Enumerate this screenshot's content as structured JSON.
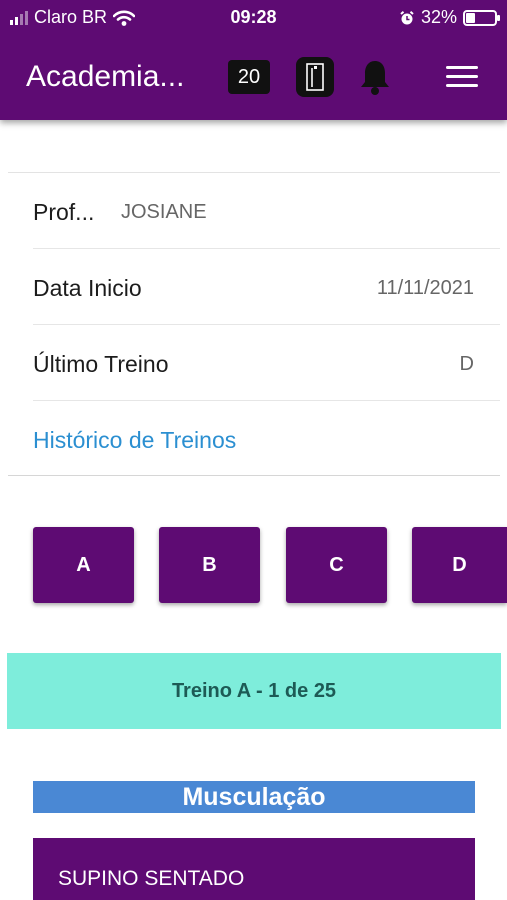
{
  "status_bar": {
    "carrier": "Claro BR",
    "time": "09:28",
    "battery_percent": "32%",
    "battery_level": 0.32
  },
  "header": {
    "title": "Academia...",
    "badge_count": "20",
    "door_icon": "door-icon",
    "bell_icon": "bell-icon",
    "menu_icon": "hamburger-menu-icon",
    "bg_color": "#5e0b73"
  },
  "info": {
    "professor_label": "Prof...",
    "professor_value": "JOSIANE",
    "start_label": "Data Inicio",
    "start_value": "11/11/2021",
    "last_label": "Último Treino",
    "last_value": "D",
    "history_link": "Histórico de Treinos"
  },
  "workouts": [
    "A",
    "B",
    "C",
    "D"
  ],
  "current_workout": "Treino A - 1 de 25",
  "section_title": "Musculação",
  "exercises": [
    "SUPINO SENTADO"
  ],
  "colors": {
    "accent": "#5e0b73",
    "link": "#2b8fd1",
    "treino_bar": "#7eeddb",
    "section": "#4a88d4"
  }
}
